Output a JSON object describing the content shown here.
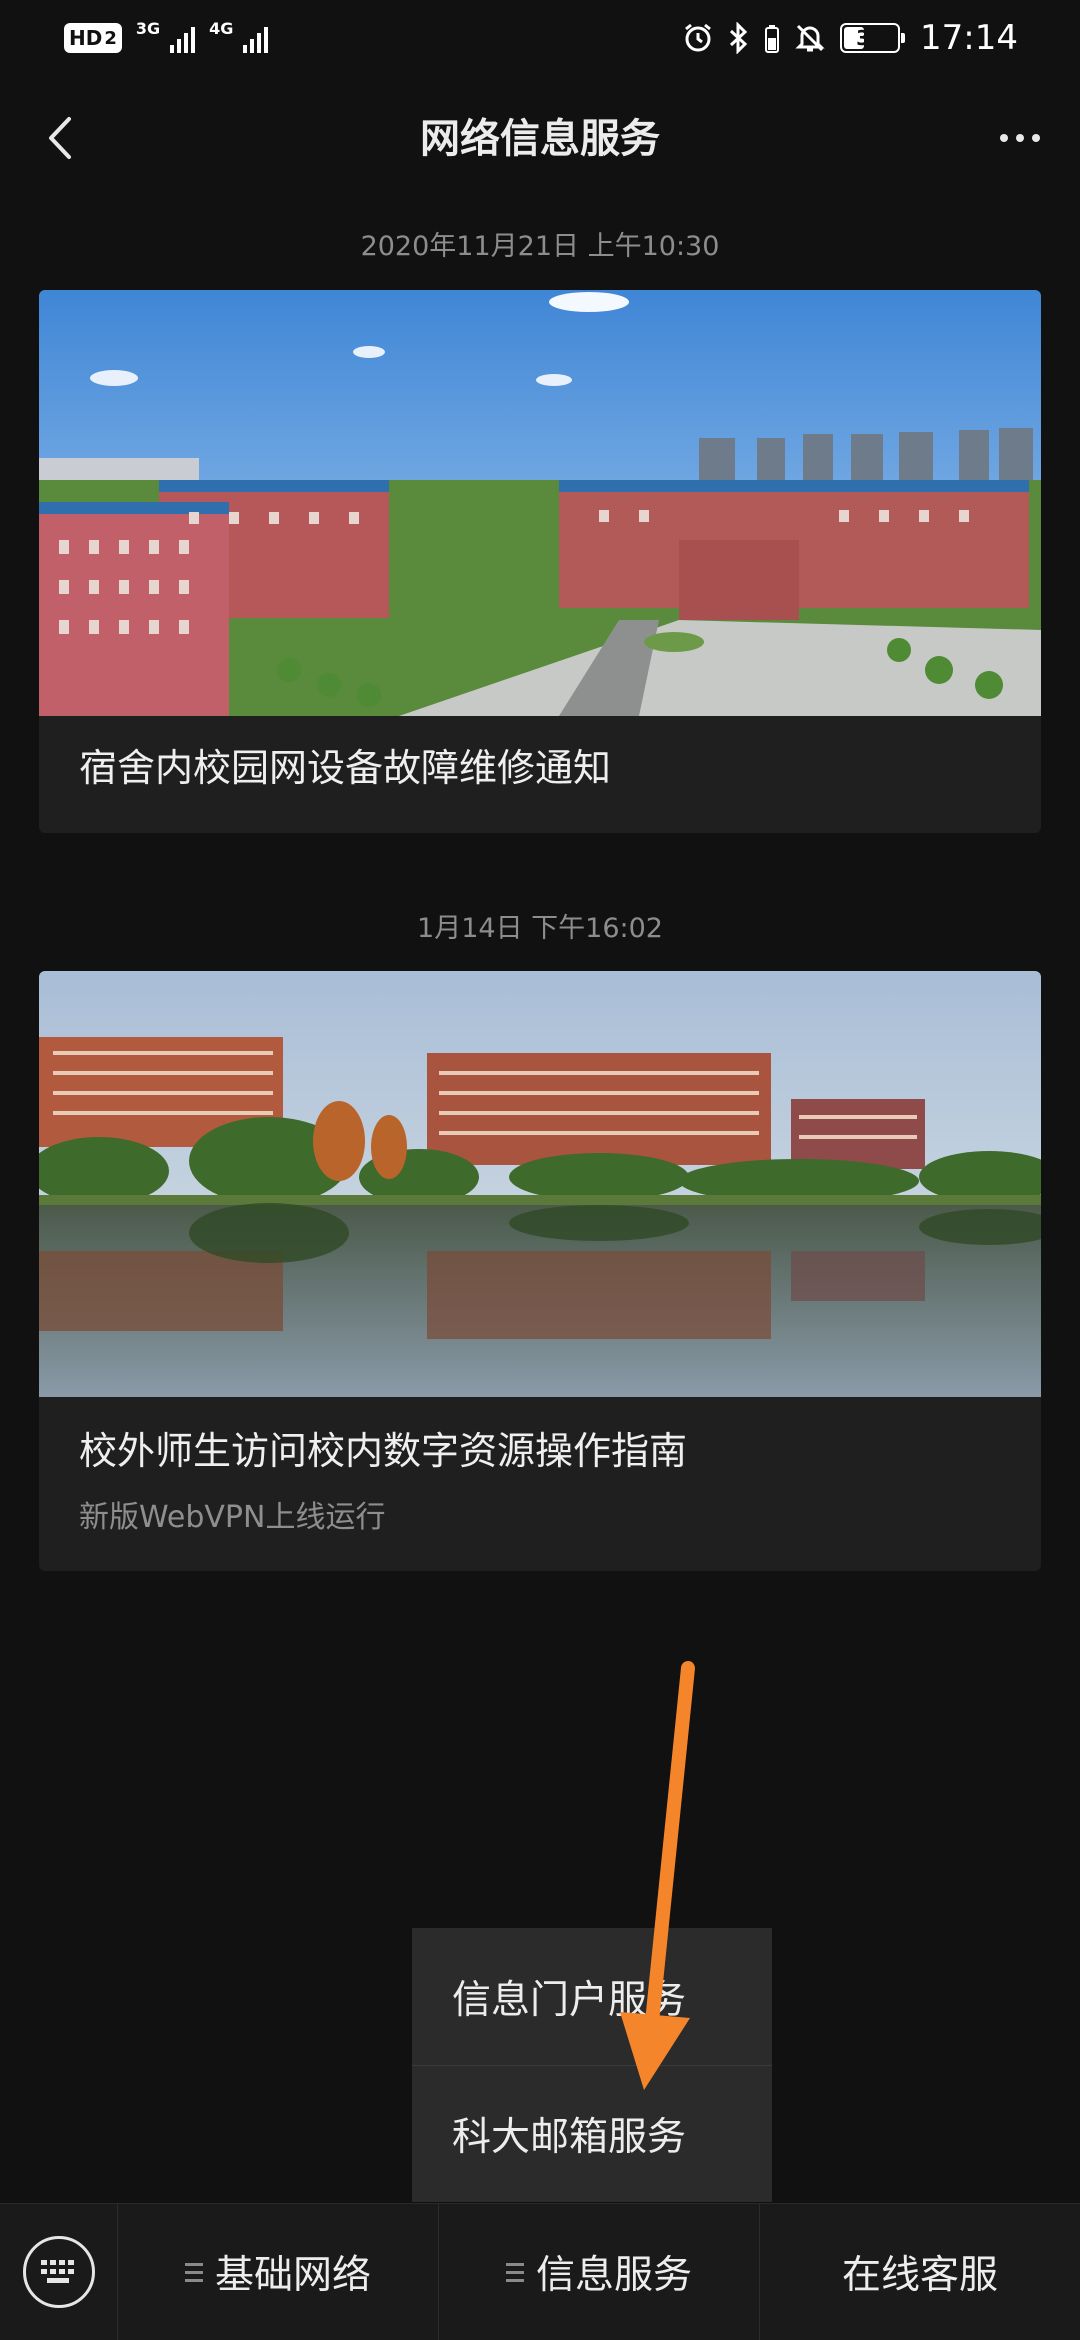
{
  "status_bar": {
    "hd_label": "HD",
    "hd_sub": "2",
    "net1_label": "3G",
    "net2_label": "4G",
    "battery": "38",
    "battery_level": 0.38,
    "time": "17:14"
  },
  "header": {
    "title": "网络信息服务"
  },
  "articles": [
    {
      "timestamp": "2020年11月21日 上午10:30",
      "title": "宿舍内校园网设备故障维修通知",
      "subtitle": ""
    },
    {
      "timestamp": "1月14日 下午16:02",
      "title": "校外师生访问校内数字资源操作指南",
      "subtitle": "新版WebVPN上线运行"
    }
  ],
  "popup_menu": {
    "items": [
      "信息门户服务",
      "科大邮箱服务"
    ]
  },
  "bottom_menu": {
    "tabs": [
      "基础网络",
      "信息服务",
      "在线客服"
    ]
  },
  "colors": {
    "background": "#111111",
    "card": "#1f1f1f",
    "popup": "#2b2b2b",
    "annotation_arrow": "#f5852a"
  },
  "icons": [
    "back-arrow-icon",
    "more-dots-icon",
    "keyboard-icon",
    "menu-lines-icon",
    "alarm-icon",
    "bluetooth-icon",
    "mute-bell-icon"
  ]
}
